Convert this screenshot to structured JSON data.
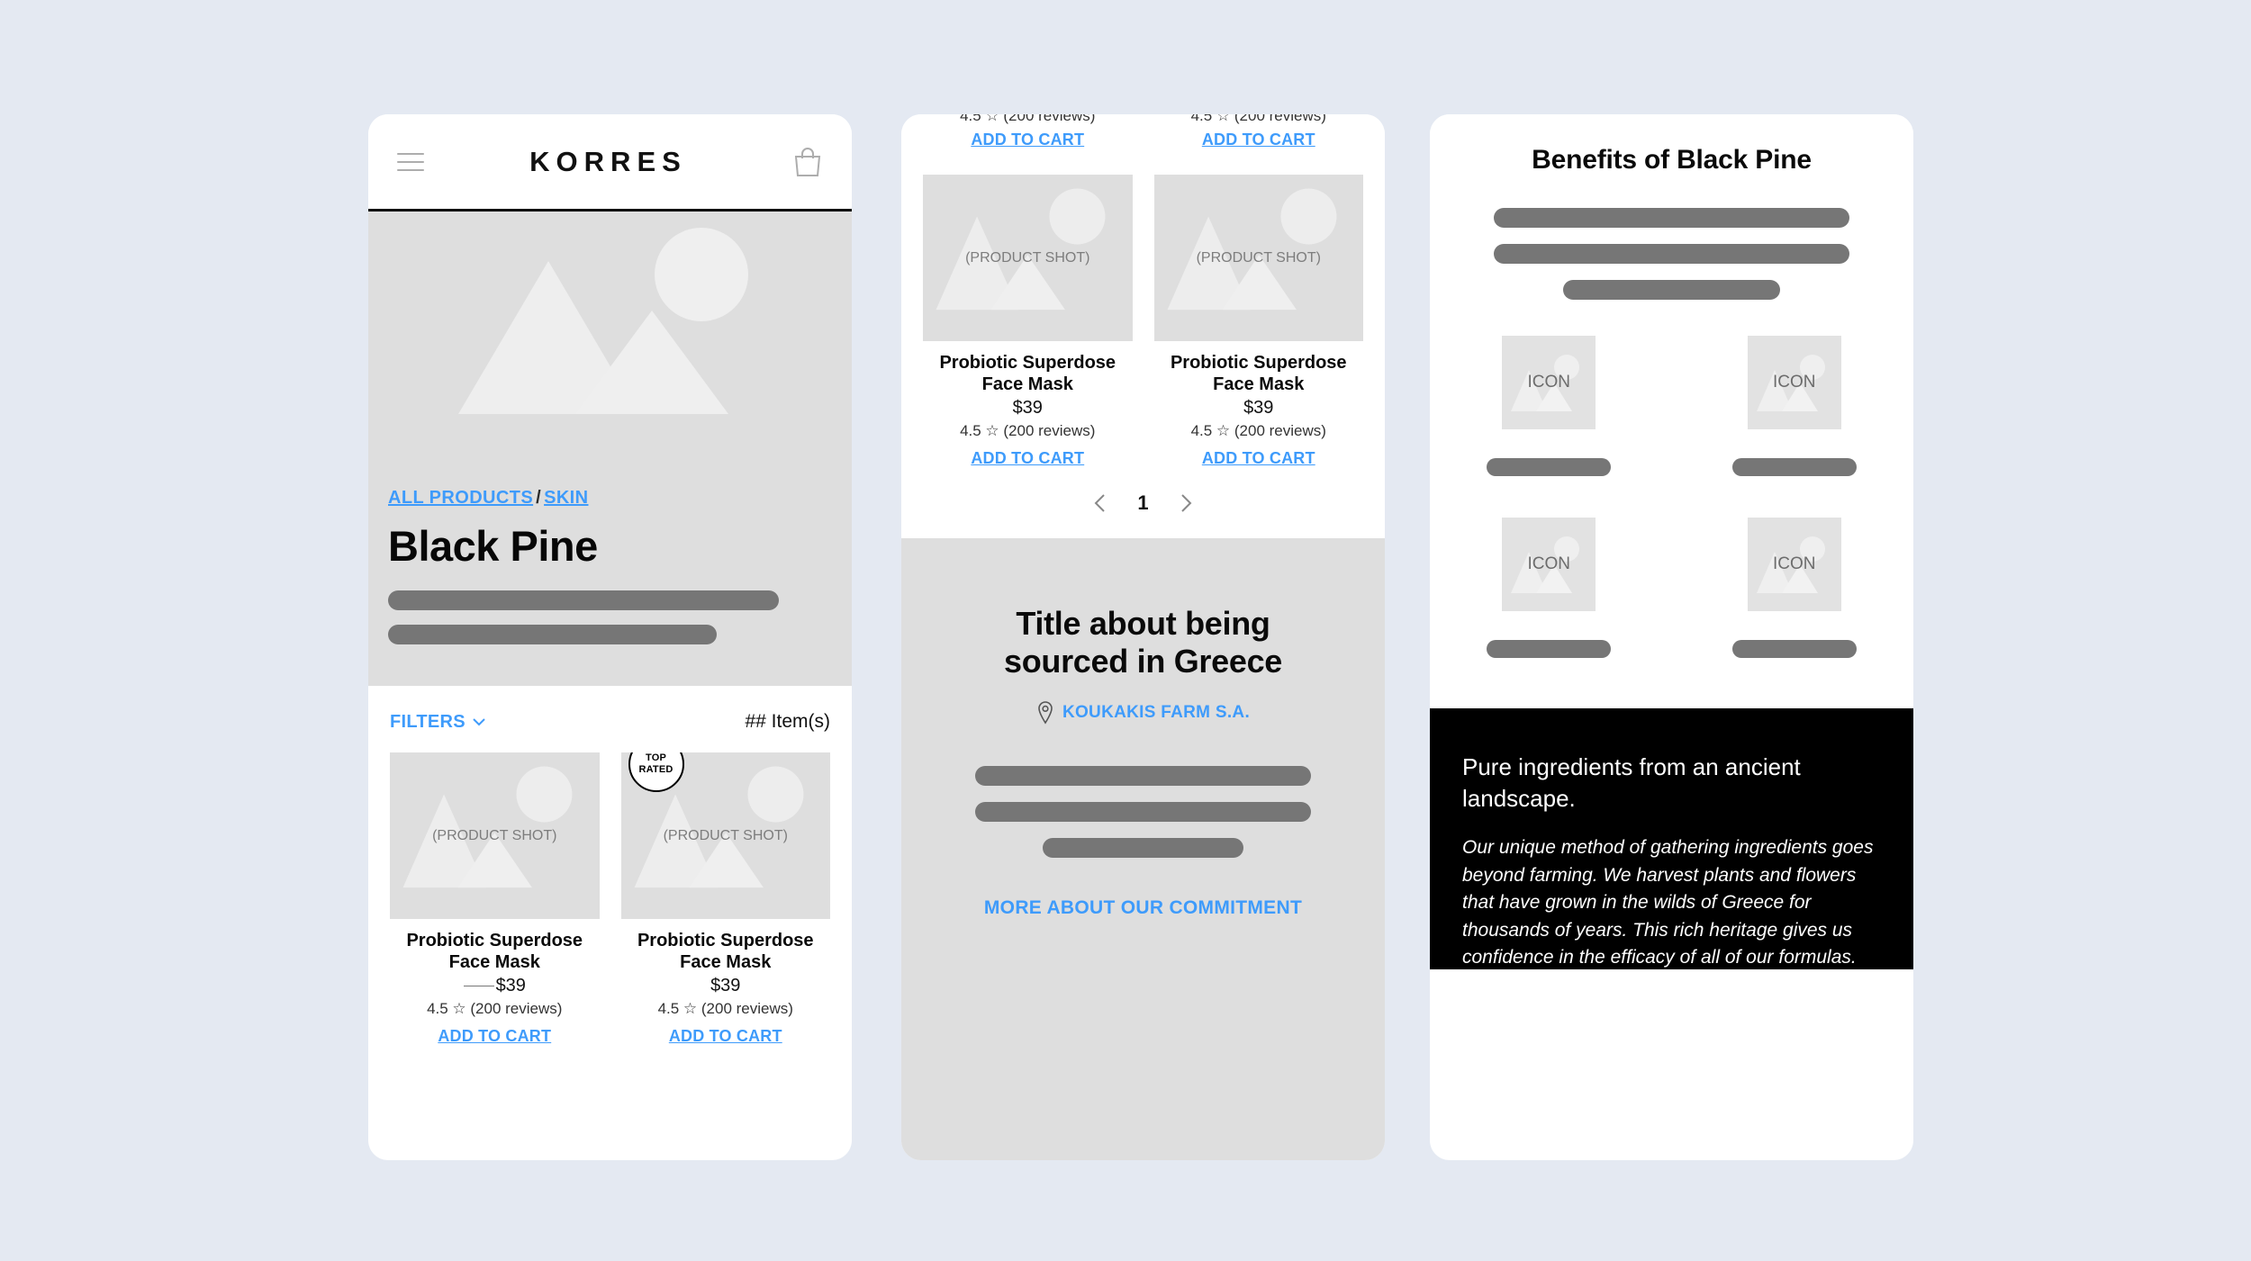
{
  "header": {
    "brand": "KORRES",
    "menu_icon": "hamburger-icon",
    "cart_icon": "shopping-bag-icon"
  },
  "hero": {
    "placeholder_caption": "",
    "breadcrumb": {
      "all_products": "ALL PRODUCTS",
      "separator": "/",
      "category": "SKIN"
    },
    "title": "Black Pine"
  },
  "filters": {
    "label": "FILTERS",
    "chevron": "chevron-down-icon",
    "item_count": "## Item(s)"
  },
  "product_card": {
    "placeholder": "(PRODUCT SHOT)",
    "name": "Probiotic Superdose Face Mask",
    "price": "$39",
    "rating": "4.5 ☆ (200 reviews)",
    "add_to_cart": "ADD TO CART",
    "badge_line1": "TOP",
    "badge_line2": "RATED"
  },
  "listing": {
    "cut_rating": "4.5 ☆ (200 reviews)",
    "add_to_cart": "ADD TO CART",
    "pagination": {
      "prev": "chevron-left-icon",
      "page": "1",
      "next": "chevron-right-icon"
    }
  },
  "sourced": {
    "title_line1": "Title about being",
    "title_line2": "sourced in Greece",
    "pin_icon": "map-pin-icon",
    "farm_name": "KOUKAKIS FARM S.A.",
    "more_link": "MORE ABOUT OUR COMMITMENT"
  },
  "benefits": {
    "title": "Benefits of Black Pine",
    "icon_label": "ICON"
  },
  "dark": {
    "heading": "Pure ingredients from an ancient landscape.",
    "body": "Our unique method of gathering ingredients goes beyond farming. We harvest plants and flowers that have grown in the wilds of Greece for thousands of years. This rich heritage gives us confidence in the efficacy of all of our formulas."
  },
  "colors": {
    "accent_link": "#3e9bfb",
    "page_background": "#e4e9f2",
    "placeholder_gray": "#dedede",
    "skeleton_gray": "#767676",
    "dark_block": "#000000"
  }
}
